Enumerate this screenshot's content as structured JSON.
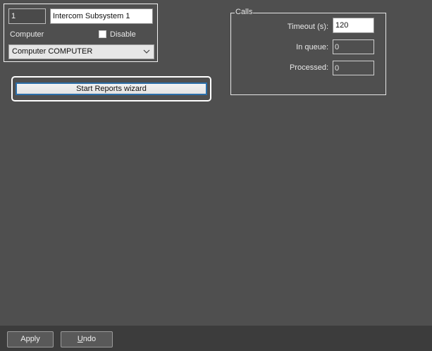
{
  "object": {
    "id_value": "1",
    "name_value": "Intercom Subsystem 1",
    "computer_label": "Computer",
    "disable_label": "Disable",
    "disable_checked": false,
    "computer_select_value": "Computer COMPUTER"
  },
  "reports": {
    "wizard_button_label": "Start Reports wizard"
  },
  "calls": {
    "group_title": "Calls",
    "timeout_label": "Timeout (s):",
    "timeout_value": "120",
    "in_queue_label": "In queue:",
    "in_queue_value": "0",
    "processed_label": "Processed:",
    "processed_value": "0"
  },
  "footer": {
    "apply_label": "Apply",
    "undo_label_first": "U",
    "undo_label_rest": "ndo"
  },
  "colors": {
    "background": "#4f4f4f",
    "footer_background": "#3c3c3c",
    "focus_border": "#2b6ea8"
  }
}
